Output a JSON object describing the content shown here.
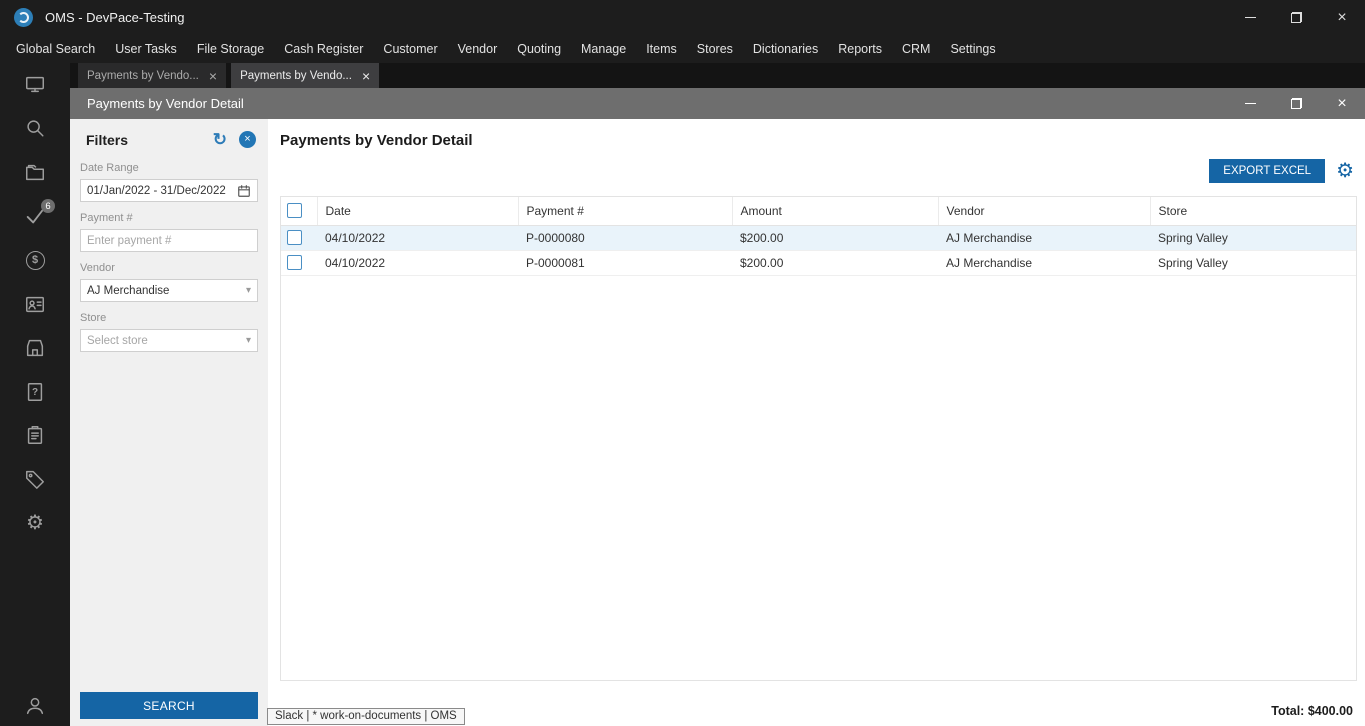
{
  "window": {
    "title": "OMS - DevPace-Testing"
  },
  "menu": {
    "items": [
      "Global Search",
      "User Tasks",
      "File Storage",
      "Cash Register",
      "Customer",
      "Vendor",
      "Quoting",
      "Manage",
      "Items",
      "Stores",
      "Dictionaries",
      "Reports",
      "CRM",
      "Settings"
    ]
  },
  "tabs": [
    {
      "label": "Payments by Vendo..."
    },
    {
      "label": "Payments by Vendo..."
    }
  ],
  "sidebar": {
    "badge": "6"
  },
  "inner_window": {
    "title": "Payments by Vendor Detail"
  },
  "filters": {
    "title": "Filters",
    "date_range_label": "Date Range",
    "date_range_value": "01/Jan/2022 - 31/Dec/2022",
    "payment_label": "Payment #",
    "payment_placeholder": "Enter payment #",
    "vendor_label": "Vendor",
    "vendor_value": "AJ Merchandise",
    "store_label": "Store",
    "store_placeholder": "Select store",
    "search_label": "SEARCH"
  },
  "main": {
    "title": "Payments by Vendor Detail",
    "export_label": "EXPORT EXCEL",
    "table": {
      "columns": [
        "Date",
        "Payment #",
        "Amount",
        "Vendor",
        "Store"
      ],
      "rows": [
        {
          "date": "04/10/2022",
          "payment": "P-0000080",
          "amount": "$200.00",
          "vendor": "AJ Merchandise",
          "store": "Spring Valley"
        },
        {
          "date": "04/10/2022",
          "payment": "P-0000081",
          "amount": "$200.00",
          "vendor": "AJ Merchandise",
          "store": "Spring Valley"
        }
      ]
    },
    "total_label": "Total:",
    "total_value": "$400.00"
  },
  "tooltip": "Slack | * work-on-documents | OMS",
  "icons": {
    "close": "×",
    "gear": "⚙",
    "refresh": "↻",
    "chevron": "▾",
    "dollar": "$",
    "question": "?",
    "expander": "▶"
  },
  "colors": {
    "accent": "#1565a5",
    "titlebar": "#1d1d1d",
    "inner_titlebar": "#6e6e6e",
    "row_highlight": "#e9f3fa",
    "filters_bg": "#f0f0f0"
  }
}
